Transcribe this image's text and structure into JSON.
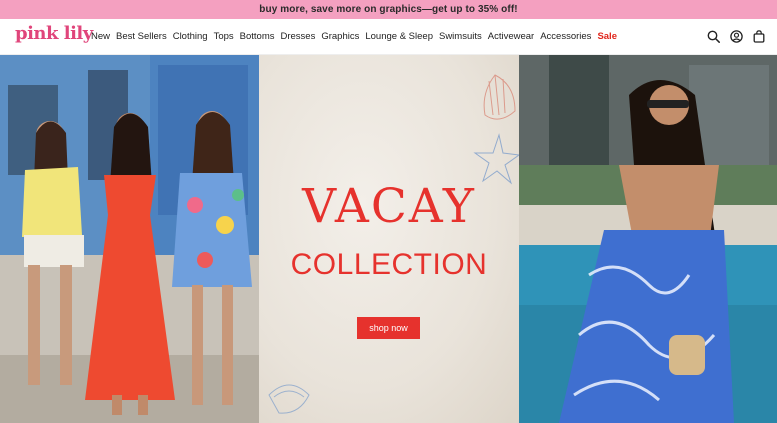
{
  "promo": {
    "text": "buy more, save more on graphics—get up to 35% off!"
  },
  "brand": {
    "logo_text": "pink lily"
  },
  "nav": {
    "items": [
      "New",
      "Best Sellers",
      "Clothing",
      "Tops",
      "Bottoms",
      "Dresses",
      "Graphics",
      "Lounge & Sleep",
      "Swimsuits",
      "Activewear",
      "Accessories"
    ],
    "sale_label": "Sale",
    "icons": [
      "search-icon",
      "account-icon",
      "bag-icon"
    ]
  },
  "hero": {
    "headline": "VACAY",
    "subheadline": "COLLECTION",
    "cta_label": "shop now"
  },
  "colors": {
    "promo_bg": "#f4a0c0",
    "brand_pink": "#e0457b",
    "accent_red": "#e6322d",
    "sale_red": "#e1251b"
  }
}
